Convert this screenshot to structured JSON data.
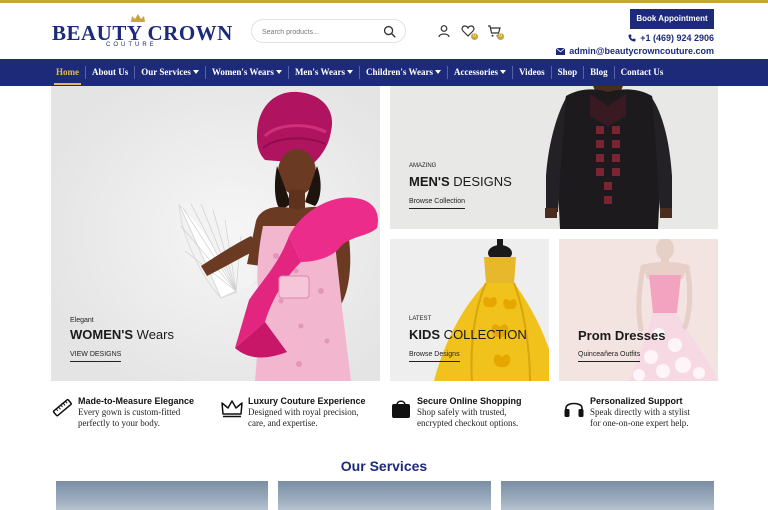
{
  "brand": {
    "name": "BEAUTY CROWN",
    "tagline": "COUTURE",
    "accent": "#c8a43a",
    "primary": "#1d2a7a"
  },
  "search": {
    "placeholder": "Search products..."
  },
  "header_icons": [
    "user-icon",
    "heart-icon",
    "cart-icon"
  ],
  "header": {
    "book_label": "Book Appointment",
    "phone": "+1 (469) 924 2906",
    "email": "admin@beautycrowncouture.com"
  },
  "nav": {
    "items": [
      {
        "label": "Home",
        "active": true,
        "dropdown": false
      },
      {
        "label": "About Us",
        "dropdown": false
      },
      {
        "label": "Our Services",
        "dropdown": true
      },
      {
        "label": "Women's Wears",
        "dropdown": true
      },
      {
        "label": "Men's Wears",
        "dropdown": true
      },
      {
        "label": "Children's Wears",
        "dropdown": true
      },
      {
        "label": "Accessories",
        "dropdown": true
      },
      {
        "label": "Videos",
        "dropdown": false
      },
      {
        "label": "Shop",
        "dropdown": false
      },
      {
        "label": "Blog",
        "dropdown": false
      },
      {
        "label": "Contact Us",
        "dropdown": false
      }
    ]
  },
  "banners": {
    "women": {
      "eyebrow": "Elegant",
      "title_bold": "WOMEN'S",
      "title_rest": " Wears",
      "link": "VIEW DESIGNS"
    },
    "men": {
      "eyebrow": "AMAZING",
      "title_bold": "MEN'S",
      "title_rest": " DESIGNS",
      "link": "Browse Collection"
    },
    "kids": {
      "eyebrow": "LATEST",
      "title_bold": "KIDS",
      "title_rest": " COLLECTION",
      "link": "Browse Designs"
    },
    "prom": {
      "eyebrow": "",
      "title_bold": "Prom Dresses",
      "title_rest": "",
      "link": "Quinceañera Outfits"
    }
  },
  "features": [
    {
      "icon": "measuring-tape-icon",
      "title": "Made-to-Measure Elegance",
      "line1": "Every gown is custom-fitted",
      "line2": "perfectly to your body."
    },
    {
      "icon": "crown-icon",
      "title": "Luxury Couture Experience",
      "line1": "Designed with royal precision,",
      "line2": "care, and expertise."
    },
    {
      "icon": "shopping-bag-icon",
      "title": "Secure Online Shopping",
      "line1": "Shop safely with trusted,",
      "line2": "encrypted checkout options."
    },
    {
      "icon": "headphones-icon",
      "title": "Personalized Support",
      "line1": "Speak directly with a stylist",
      "line2": "for one-on-one expert help."
    }
  ],
  "services": {
    "title": "Our Services"
  }
}
